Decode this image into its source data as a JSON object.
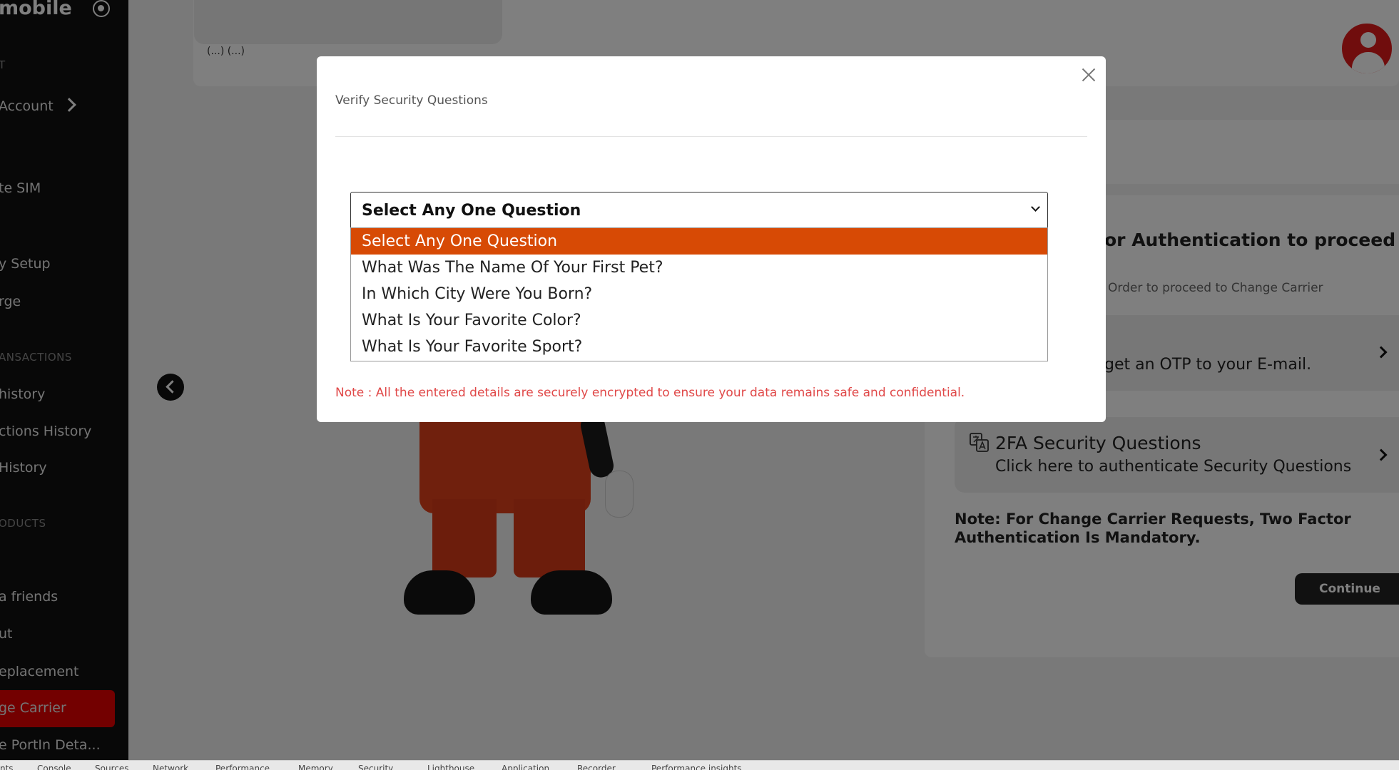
{
  "sidebar": {
    "brand": "mobile",
    "sections": [
      "T",
      "ANSACTIONS",
      "ODUCTS"
    ],
    "items": [
      "Account",
      "te SIM",
      "y Setup",
      "rge",
      "history",
      "ctions History",
      "History",
      "a friends",
      "ut",
      "eplacement",
      "ge Carrier",
      "e PortIn Deta..."
    ]
  },
  "header": {
    "text": "(...) (...)"
  },
  "right_panel": {
    "title": "or Authentication to proceed wi",
    "subtitle": "Order to proceed to Change Carrier",
    "option_email_text": "get an OTP to your E-mail.",
    "option_2fa_title": "2FA Security Questions",
    "option_2fa_subtitle": "Click here to authenticate Security Questions",
    "note": "Note: For Change Carrier Requests, Two Factor Authentication Is Mandatory.",
    "continue_label": "Continue"
  },
  "modal": {
    "title": "Verify Security Questions",
    "select": {
      "selected": "Select Any One Question",
      "options": [
        "Select Any One Question",
        "What Was The Name Of Your First Pet?",
        "In Which City Were You Born?",
        "What Is Your Favorite Color?",
        "What Is Your Favorite Sport?"
      ]
    },
    "note": "Note : All the entered details are securely encrypted to ensure your data remains safe and confidential."
  },
  "devtools": {
    "tabs": [
      "nts",
      "Console",
      "Sources",
      "Network",
      "Performance",
      "Memory",
      "Security",
      "Lighthouse",
      "Application",
      "Recorder",
      "Performance insights"
    ]
  },
  "colors": {
    "accent": "#d74a05",
    "sidebar_active": "#e60000",
    "note_red": "#e04848"
  }
}
